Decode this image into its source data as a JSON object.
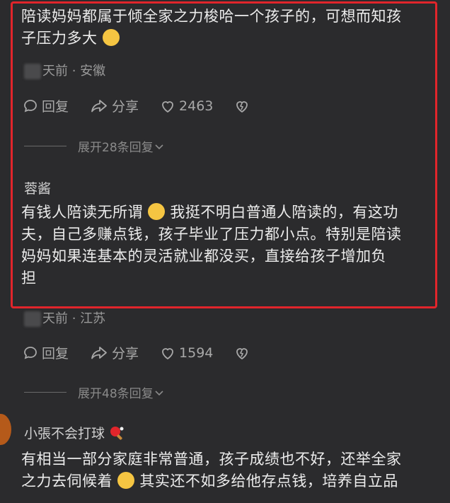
{
  "comments": [
    {
      "text_line1": "陪读妈妈都属于倾全家之力梭哈一个孩子的，可想而知孩",
      "text_line2": "子压力多大",
      "meta_suffix": "天前 · 安徽",
      "reply_label": "回复",
      "share_label": "分享",
      "like_count": "2463",
      "expand_label": "展开28条回复"
    },
    {
      "username": "蓉酱",
      "text_line1": "有钱人陪读无所谓",
      "text_line1b": "我挺不明白普通人陪读的，有这功",
      "text_line2": "夫，自己多赚点钱，孩子毕业了压力都小点。特别是陪读",
      "text_line3": "妈妈如果连基本的灵活就业都没买，直接给孩子增加负",
      "text_line4": "担",
      "meta_suffix": "天前 · 江苏",
      "reply_label": "回复",
      "share_label": "分享",
      "like_count": "1594",
      "expand_label": "展开48条回复"
    },
    {
      "username": "小張不会打球",
      "text_line1": "有相当一部分家庭非常普通，孩子成绩也不好，还举全家",
      "text_line2a": "之力去伺候着",
      "text_line2b": "其实还不如多给他存点钱，培养自立品"
    }
  ],
  "colors": {
    "highlight": "#e1252b",
    "background": "#2b2b2d"
  }
}
